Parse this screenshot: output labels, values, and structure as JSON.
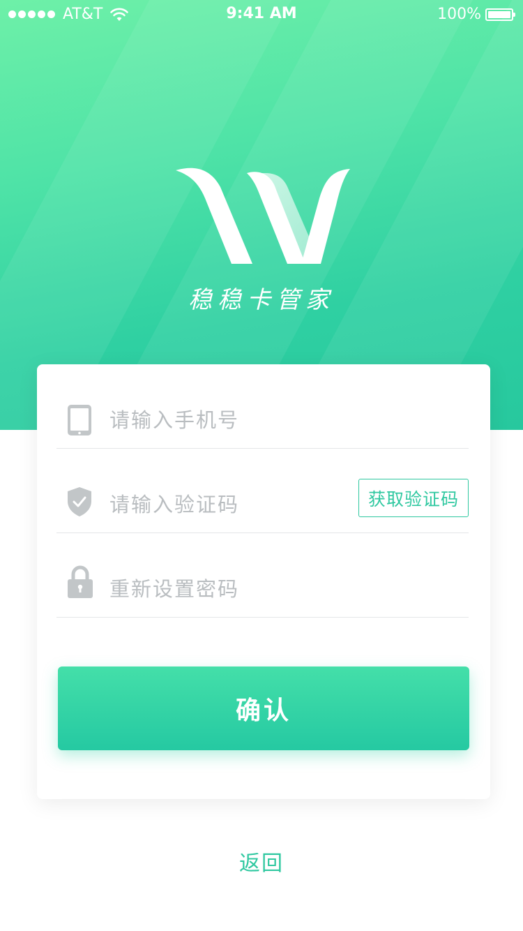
{
  "status_bar": {
    "carrier": "AT&T",
    "time": "9:41 AM",
    "battery": "100%"
  },
  "brand": {
    "app_name": "稳稳卡管家",
    "logo_icon": "w-logo-icon",
    "accent_color": "#2fc8a0"
  },
  "form": {
    "phone": {
      "icon": "mobile-phone-icon",
      "placeholder": "请输入手机号",
      "value": ""
    },
    "code": {
      "icon": "shield-check-icon",
      "placeholder": "请输入验证码",
      "value": "",
      "get_code_label": "获取验证码"
    },
    "password": {
      "icon": "lock-icon",
      "placeholder": "重新设置密码",
      "value": ""
    },
    "confirm_label": "确认"
  },
  "footer": {
    "back_label": "返回"
  }
}
